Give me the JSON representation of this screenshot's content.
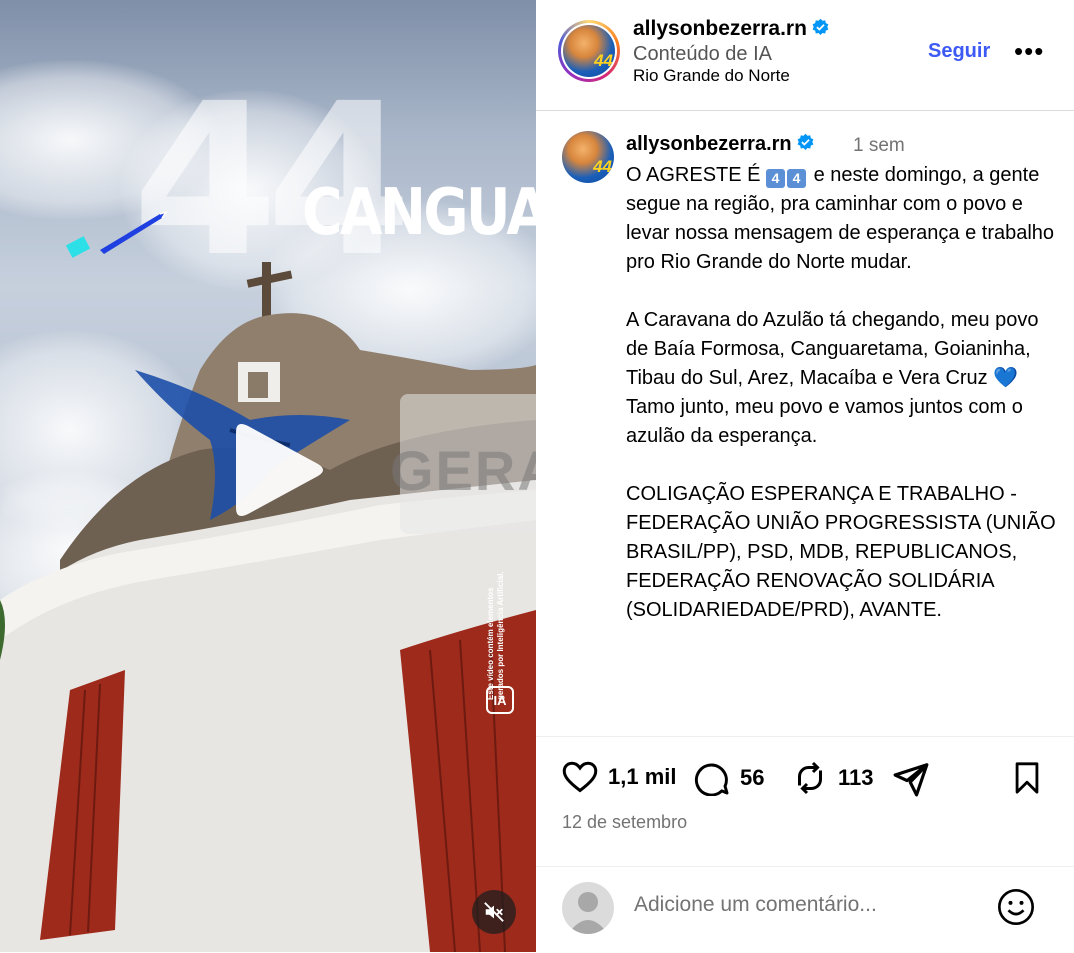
{
  "media": {
    "overlay_title": "CANGUARET",
    "big_number": "44",
    "watermark": "GERADO POR IA",
    "vertical_note": "Este vídeo contém elementos gerados por Inteligência Artificial.",
    "ia_badge": "IA",
    "play_icon": "play-icon",
    "mute_icon": "speaker-muted-icon"
  },
  "header": {
    "username": "allysonbezerra.rn",
    "subtitle": "Conteúdo de IA",
    "location": "Rio Grande do Norte",
    "follow_label": "Seguir",
    "more_label": "•••",
    "avatar_number": "44"
  },
  "caption": {
    "username": "allysonbezerra.rn",
    "time": "1 sem",
    "line1_pre": "O AGRESTE É ",
    "keycap1": "4",
    "keycap2": "4",
    "line1_post": " e neste domingo, a gente segue na região, pra caminhar com o povo e levar nossa mensagem de esperança e trabalho pro Rio Grande do Norte mudar.",
    "para2_pre": "A Caravana do Azulão tá chegando, meu povo de Baía Formosa, Canguaretama, Goianinha, Tibau do Sul, Arez, Macaíba e Vera Cruz ",
    "para2_heart": "💙",
    "para2_post": " Tamo junto, meu povo e vamos juntos com o azulão da esperança.",
    "para3": "COLIGAÇÃO ESPERANÇA E TRABALHO - FEDERAÇÃO UNIÃO PROGRESSISTA (UNIÃO BRASIL/PP), PSD, MDB, REPUBLICANOS, FEDERAÇÃO RENOVAÇÃO SOLIDÁRIA (SOLIDARIEDADE/PRD), AVANTE."
  },
  "actions": {
    "likes": "1,1 mil",
    "comments": "56",
    "reposts": "113"
  },
  "date": "12 de setembro",
  "comment_input": {
    "placeholder": "Adicione um comentário..."
  },
  "colors": {
    "accent_blue": "#3d5af5",
    "verified_blue": "#0095f6",
    "muted_text": "#737373"
  }
}
